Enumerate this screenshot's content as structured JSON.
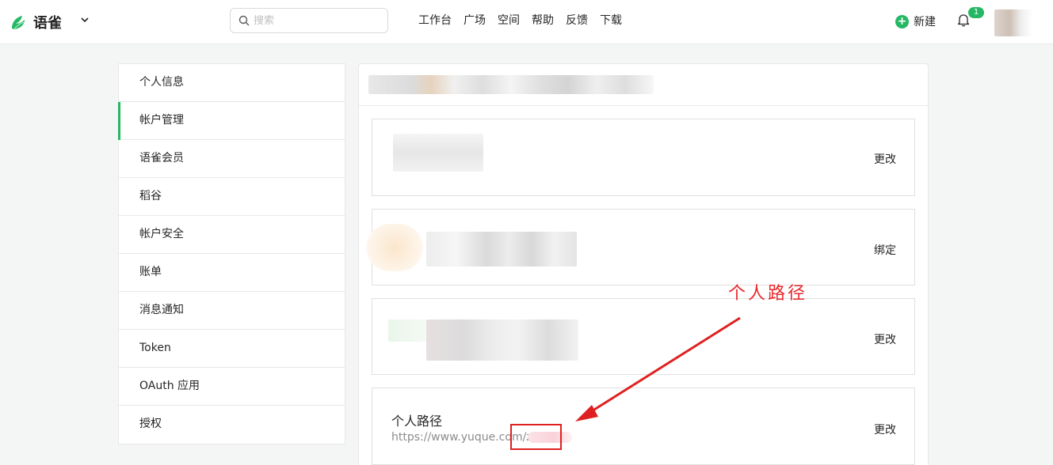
{
  "header": {
    "logo_text": "语雀",
    "search_placeholder": "搜索",
    "nav": [
      "工作台",
      "广场",
      "空间",
      "帮助",
      "反馈",
      "下载"
    ],
    "new_label": "新建",
    "notification_count": "1"
  },
  "sidebar": {
    "items": [
      {
        "label": "个人信息",
        "active": false
      },
      {
        "label": "帐户管理",
        "active": true
      },
      {
        "label": "语雀会员",
        "active": false
      },
      {
        "label": "稻谷",
        "active": false
      },
      {
        "label": "帐户安全",
        "active": false
      },
      {
        "label": "账单",
        "active": false
      },
      {
        "label": "消息通知",
        "active": false
      },
      {
        "label": "Token",
        "active": false
      },
      {
        "label": "OAuth 应用",
        "active": false
      },
      {
        "label": "授权",
        "active": false
      }
    ]
  },
  "main": {
    "cards": [
      {
        "action": "更改"
      },
      {
        "action": "绑定"
      },
      {
        "action": "更改"
      },
      {
        "title": "个人路径",
        "url": "https://www.yuque.com/z",
        "action": "更改"
      }
    ]
  },
  "annotation": {
    "text": "个人路径",
    "color": "#e8292c"
  },
  "colors": {
    "accent": "#25b864",
    "annotation_red": "#e02020"
  }
}
